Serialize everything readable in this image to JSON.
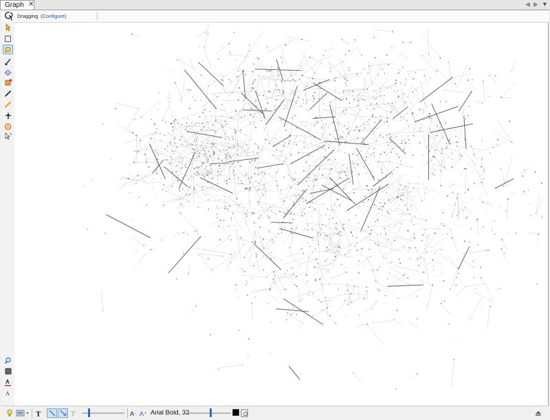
{
  "tab": {
    "label": "Graph",
    "close": "✕"
  },
  "tab_nav": {
    "prev": "◀",
    "next": "▶",
    "menu": "▼"
  },
  "info": {
    "mode": "Dragging",
    "configure": "(Configure)"
  },
  "bottom": {
    "font": "Arial Bold, 32",
    "edge_size_level": 0.15,
    "label_size_level": 0.5
  },
  "colors": {
    "accent": "#1f6fc4",
    "link": "#1a4fb5",
    "edge": "#555555"
  },
  "left_tools": [
    "pointer-icon",
    "rectangle-select-icon",
    "lasso-select-icon",
    "brush-icon",
    "painter-icon",
    "paint-bucket-icon",
    "pencil-icon",
    "ruler-icon",
    "airplane-icon",
    "shortest-path-icon",
    "edit-node-icon"
  ]
}
